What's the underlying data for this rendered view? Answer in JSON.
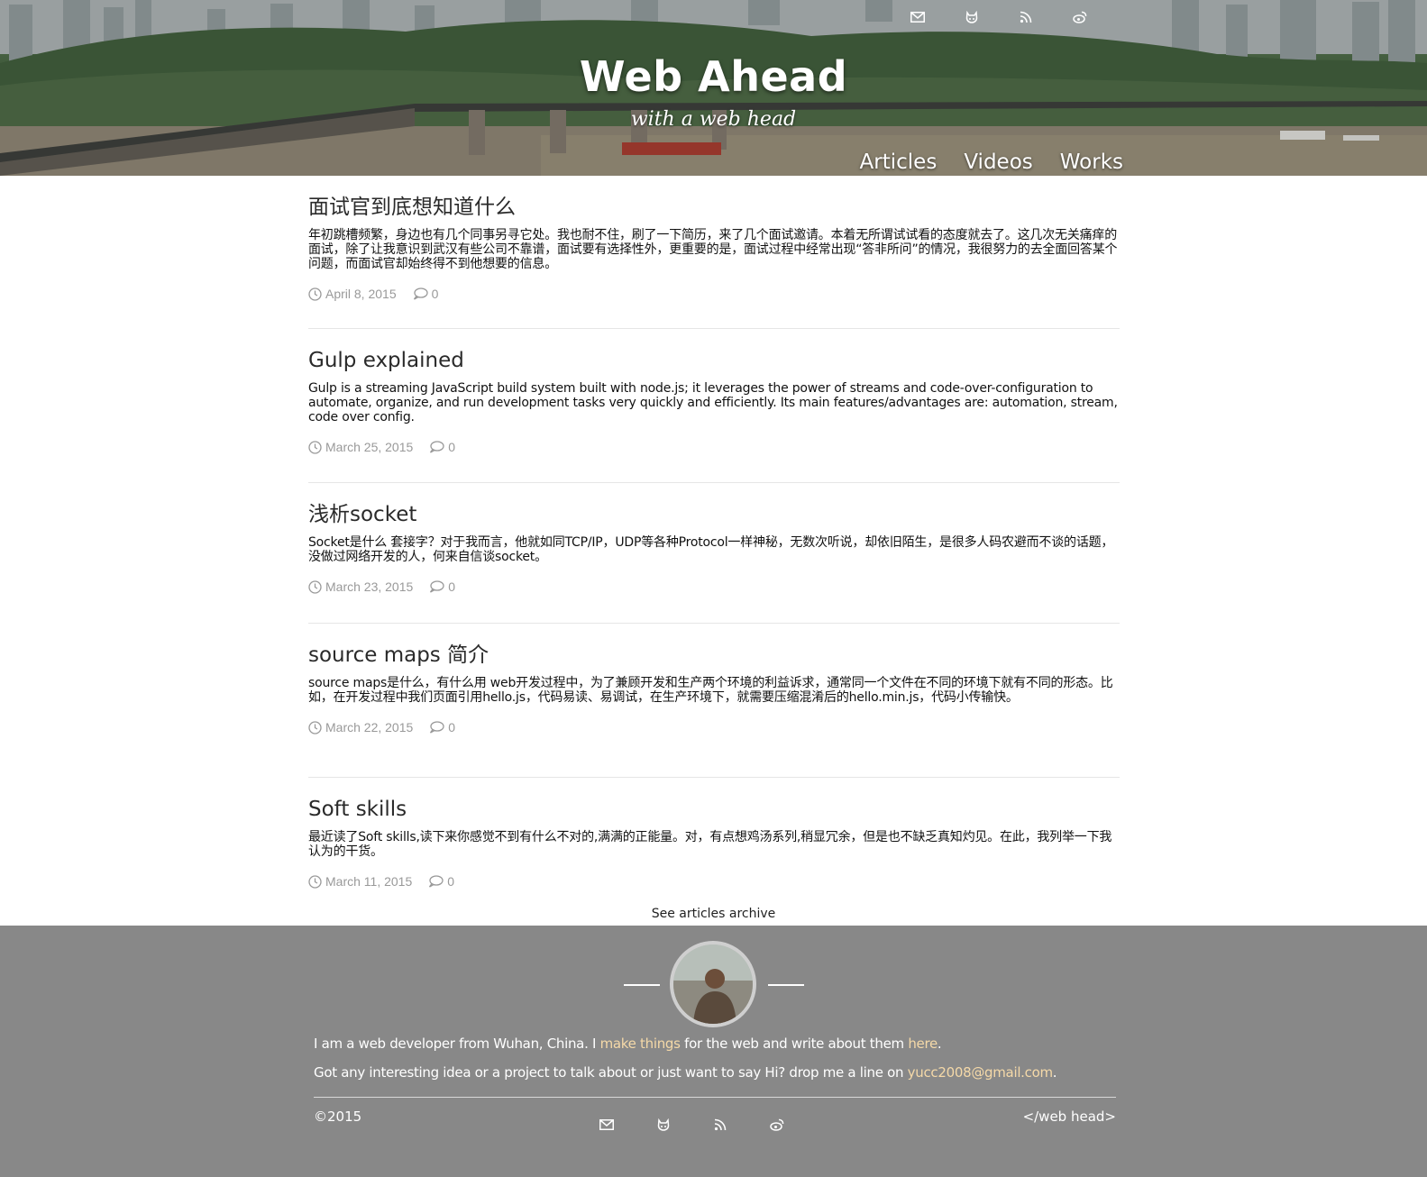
{
  "header": {
    "title": "Web Ahead",
    "subtitle": "with a web head",
    "social_icons": [
      "mail-icon",
      "github-icon",
      "rss-icon",
      "weibo-icon"
    ],
    "nav": [
      "Articles",
      "Videos",
      "Works"
    ]
  },
  "articles": [
    {
      "title": "面试官到底想知道什么",
      "excerpt": "年初跳槽频繁，身边也有几个同事另寻它处。我也耐不住，刷了一下简历，来了几个面试邀请。本着无所谓试试看的态度就去了。这几次无关痛痒的面试，除了让我意识到武汉有些公司不靠谱，面试要有选择性外，更重要的是，面试过程中经常出现“答非所问”的情况，我很努力的去全面回答某个问题，而面试官却始终得不到他想要的信息。",
      "date": "April 8, 2015",
      "comments": "0"
    },
    {
      "title": "Gulp explained",
      "excerpt": "Gulp is a streaming JavaScript build system built with node.js; it leverages the power of streams and code-over-configuration to automate, organize, and run development tasks very quickly and efficiently. Its main features/advantages are: automation, stream, code over config.",
      "date": "March 25, 2015",
      "comments": "0"
    },
    {
      "title": "浅析socket",
      "excerpt": "Socket是什么 套接字？对于我而言，他就如同TCP/IP，UDP等各种Protocol一样神秘，无数次听说，却依旧陌生，是很多人码农避而不谈的话题，没做过网络开发的人，何来自信谈socket。",
      "date": "March 23, 2015",
      "comments": "0"
    },
    {
      "title": "source maps 简介",
      "excerpt": "source maps是什么，有什么用 web开发过程中，为了兼顾开发和生产两个环境的利益诉求，通常同一个文件在不同的环境下就有不同的形态。比如，在开发过程中我们页面引用hello.js，代码易读、易调试，在生产环境下，就需要压缩混淆后的hello.min.js，代码小传输快。",
      "date": "March 22, 2015",
      "comments": "0"
    },
    {
      "title": "Soft skills",
      "excerpt": "最近读了Soft skills,读下来你感觉不到有什么不对的,满满的正能量。对，有点想鸡汤系列,稍显冗余，但是也不缺乏真知灼见。在此，我列举一下我认为的干货。",
      "date": "March 11, 2015",
      "comments": "0"
    }
  ],
  "archive_link": "See articles archive",
  "footer": {
    "about_1_pre": "I am a web developer from Wuhan, China. I ",
    "about_1_link1": "make things",
    "about_1_mid": " for the web and write about them ",
    "about_1_link2": "here",
    "about_1_post": ".",
    "about_2_pre": "Got any interesting idea or a project to talk about or just want to say Hi? drop me a line on ",
    "about_2_email": "yucc2008@gmail.com",
    "about_2_post": ".",
    "copyright": "©2015",
    "brand": "</web head>",
    "social_icons": [
      "mail-icon",
      "github-icon",
      "rss-icon",
      "weibo-icon"
    ],
    "link_color": "#f5d9a8",
    "background_color": "#888888"
  }
}
